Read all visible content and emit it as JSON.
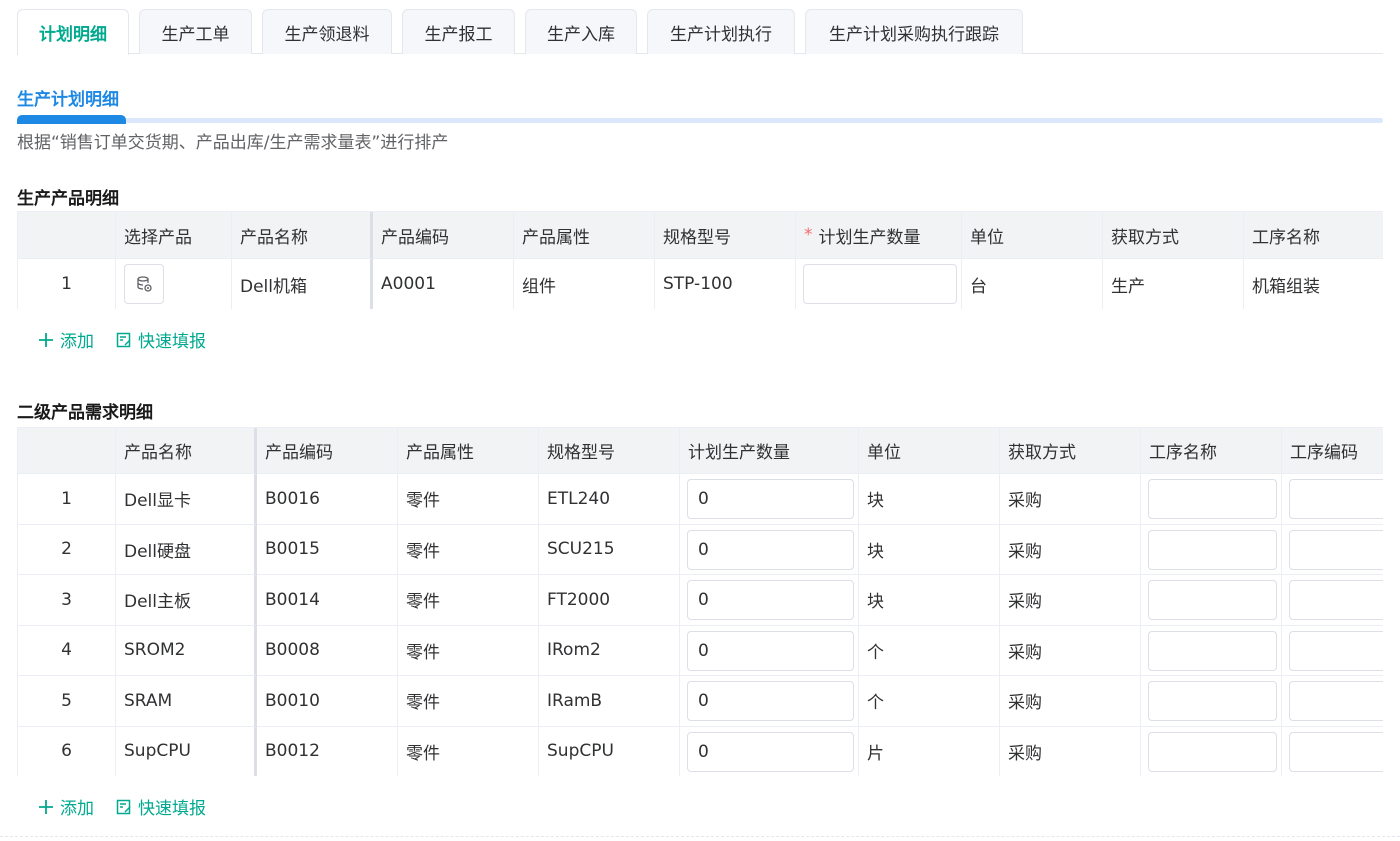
{
  "tabs": [
    {
      "label": "计划明细",
      "active": true
    },
    {
      "label": "生产工单",
      "active": false
    },
    {
      "label": "生产领退料",
      "active": false
    },
    {
      "label": "生产报工",
      "active": false
    },
    {
      "label": "生产入库",
      "active": false
    },
    {
      "label": "生产计划执行",
      "active": false
    },
    {
      "label": "生产计划采购执行跟踪",
      "active": false
    }
  ],
  "section": {
    "title": "生产计划明细",
    "description": "根据“销售订单交货期、产品出库/生产需求量表”进行排产"
  },
  "products": {
    "title": "生产产品明细",
    "headers": {
      "index": "",
      "select": "选择产品",
      "name": "产品名称",
      "code": "产品编码",
      "attr": "产品属性",
      "spec": "规格型号",
      "qty_required_mark": "*",
      "qty": "计划生产数量",
      "unit": "单位",
      "method": "获取方式",
      "process": "工序名称"
    },
    "rows": [
      {
        "index": "1",
        "name": "Dell机箱",
        "code": "A0001",
        "attr": "组件",
        "spec": "STP-100",
        "qty": "",
        "unit": "台",
        "method": "生产",
        "process": "机箱组装"
      }
    ],
    "add_label": "添加",
    "quick_fill_label": "快速填报"
  },
  "secondary": {
    "title": "二级产品需求明细",
    "headers": {
      "index": "",
      "name": "产品名称",
      "code": "产品编码",
      "attr": "产品属性",
      "spec": "规格型号",
      "qty": "计划生产数量",
      "unit": "单位",
      "method": "获取方式",
      "process_name": "工序名称",
      "process_code": "工序编码"
    },
    "rows": [
      {
        "index": "1",
        "name": "Dell显卡",
        "code": "B0016",
        "attr": "零件",
        "spec": "ETL240",
        "qty": "0",
        "unit": "块",
        "method": "采购"
      },
      {
        "index": "2",
        "name": "Dell硬盘",
        "code": "B0015",
        "attr": "零件",
        "spec": "SCU215",
        "qty": "0",
        "unit": "块",
        "method": "采购"
      },
      {
        "index": "3",
        "name": "Dell主板",
        "code": "B0014",
        "attr": "零件",
        "spec": "FT2000",
        "qty": "0",
        "unit": "块",
        "method": "采购"
      },
      {
        "index": "4",
        "name": "SROM2",
        "code": "B0008",
        "attr": "零件",
        "spec": "IRom2",
        "qty": "0",
        "unit": "个",
        "method": "采购"
      },
      {
        "index": "5",
        "name": "SRAM",
        "code": "B0010",
        "attr": "零件",
        "spec": "IRamB",
        "qty": "0",
        "unit": "个",
        "method": "采购"
      },
      {
        "index": "6",
        "name": "SupCPU",
        "code": "B0012",
        "attr": "零件",
        "spec": "SupCPU",
        "qty": "0",
        "unit": "片",
        "method": "采购"
      }
    ],
    "add_label": "添加",
    "quick_fill_label": "快速填报"
  },
  "colors": {
    "accent": "#00a98f",
    "section_blue": "#1e88e5",
    "required": "#f56c6c"
  }
}
